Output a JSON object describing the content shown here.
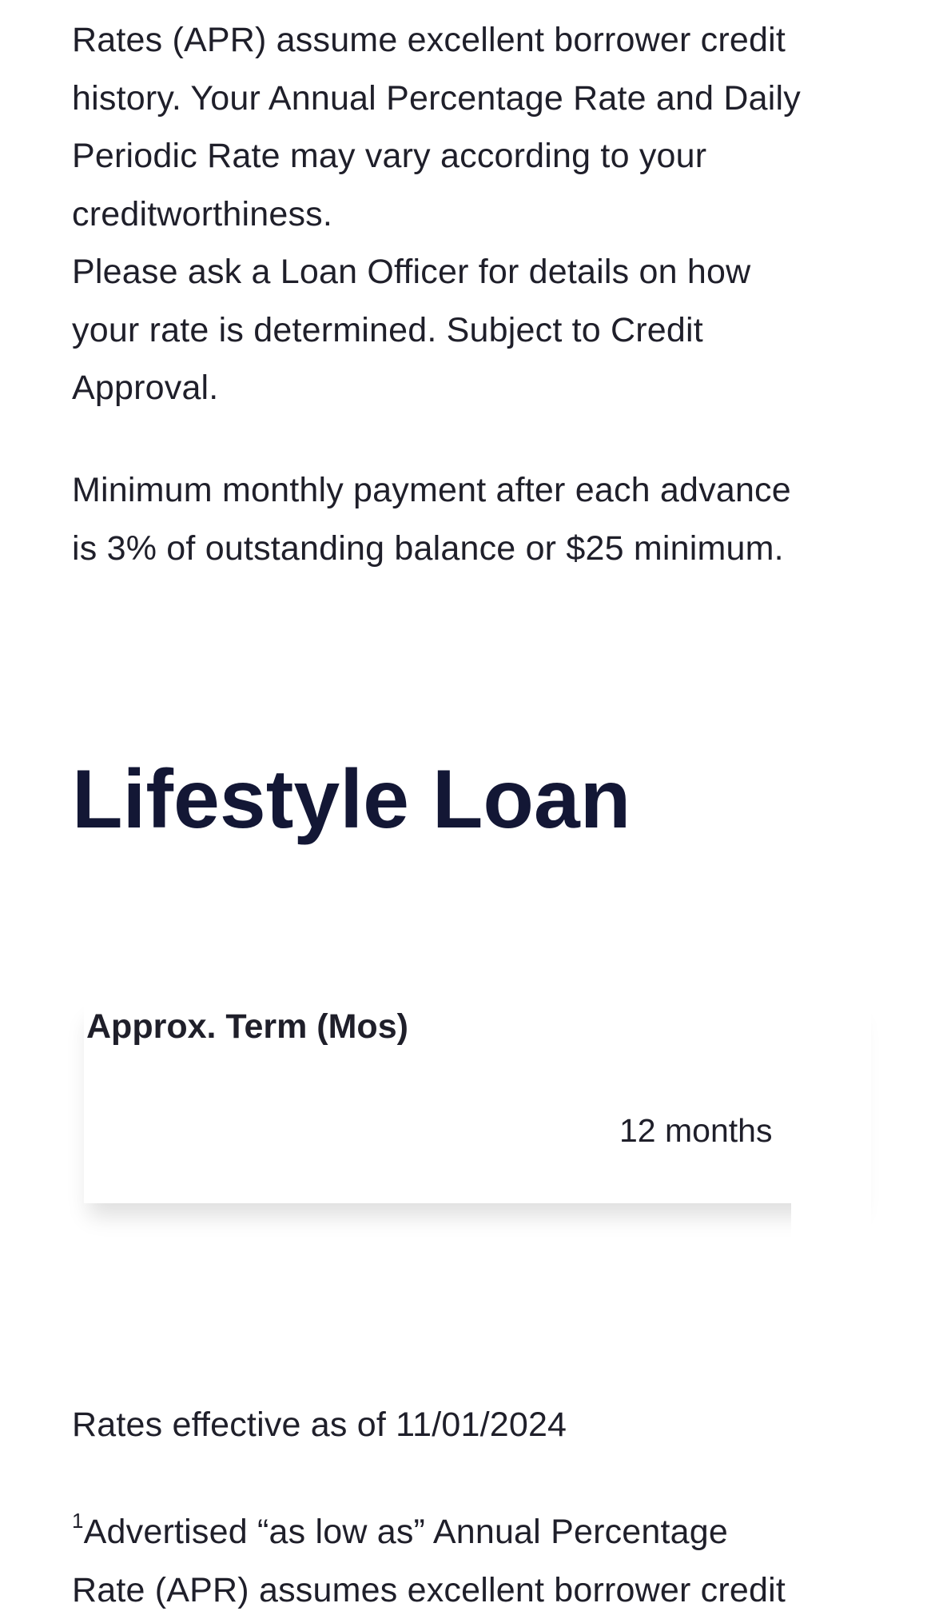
{
  "disclaimer": {
    "lines": [
      "Rates (APR) assume excellent borrower credit",
      "history. Your Annual Percentage Rate and Daily",
      "Periodic Rate may vary according to your",
      "creditworthiness.",
      "Please ask a Loan Officer for details on how",
      "your rate is determined. Subject to Credit",
      "Approval."
    ],
    "minimum_payment_lines": [
      "Minimum monthly payment after each advance",
      "is 3% of outstanding balance or $25 minimum."
    ]
  },
  "lifestyle_loan": {
    "title": "Lifestyle Loan",
    "table": {
      "header": "Approx. Term (Mos)",
      "rows": [
        {
          "term": "12 months"
        }
      ]
    }
  },
  "rates_effective": "Rates effective as of 11/01/2024",
  "footnote": {
    "marker": "1",
    "lines": [
      "Advertised “as low as” Annual Percentage",
      "Rate (APR) assumes excellent borrower credit"
    ]
  }
}
